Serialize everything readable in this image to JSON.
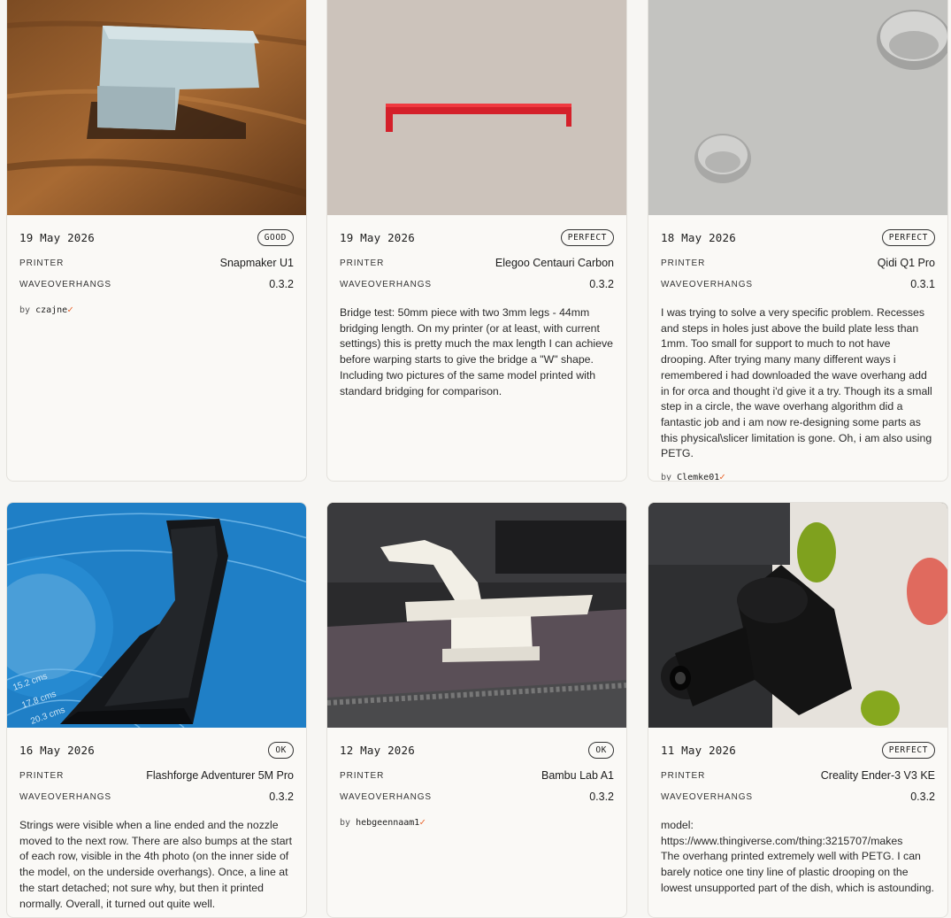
{
  "cards": [
    {
      "date": "19 May 2026",
      "rating": "GOOD",
      "printer_label": "PRINTER",
      "printer": "Snapmaker U1",
      "plugin_label": "WAVEOVERHANGS",
      "version": "0.3.2",
      "description": "",
      "by": "by",
      "author": "czajne",
      "verified": "✓",
      "image_icon": "photo-gray-block-on-wood"
    },
    {
      "date": "19 May 2026",
      "rating": "PERFECT",
      "printer_label": "PRINTER",
      "printer": "Elegoo Centauri Carbon",
      "plugin_label": "WAVEOVERHANGS",
      "version": "0.3.2",
      "description": "Bridge test: 50mm piece with two 3mm legs - 44mm bridging length. On my printer (or at least, with current settings) this is pretty much the max length I can achieve before warping starts to give the bridge a \"W\" shape. Including two pictures of the same model printed with standard bridging for comparison.",
      "by": "",
      "author": "",
      "verified": "",
      "image_icon": "photo-red-bridge"
    },
    {
      "date": "18 May 2026",
      "rating": "PERFECT",
      "printer_label": "PRINTER",
      "printer": "Qidi Q1 Pro",
      "plugin_label": "WAVEOVERHANGS",
      "version": "0.3.1",
      "description": "I was trying to solve a very specific problem. Recesses and steps in holes just above the build plate less than 1mm. Too small for support to much to not have drooping. After trying many many different ways i remembered i had downloaded the wave overhang add in for orca and thought i'd give it a try. Though its a small step in a circle, the wave overhang algorithm did a fantastic job and i am now re-designing some parts as this physical\\slicer limitation is gone. Oh, i am also using PETG.",
      "by": "by",
      "author": "Clemke01",
      "verified": "✓",
      "image_icon": "photo-gray-recesses"
    },
    {
      "date": "16 May 2026",
      "rating": "OK",
      "printer_label": "PRINTER",
      "printer": "Flashforge Adventurer 5M Pro",
      "plugin_label": "WAVEOVERHANGS",
      "version": "0.3.2",
      "description": "Strings were visible when a line ended and the nozzle moved to the next row. There are also bumps at the start of each row, visible in the 4th photo (on the inner side of the model, on the underside overhangs). Once, a line at the start detached; not sure why, but then it printed normally. Overall, it turned out quite well.",
      "by": "",
      "author": "",
      "verified": "",
      "image_icon": "photo-black-clip-on-blue-mat",
      "mat_labels": [
        "15.2 cms",
        "17.8 cms",
        "20.3 cms"
      ]
    },
    {
      "date": "12 May 2026",
      "rating": "OK",
      "printer_label": "PRINTER",
      "printer": "Bambu Lab A1",
      "plugin_label": "WAVEOVERHANGS",
      "version": "0.3.2",
      "description": "",
      "by": "by",
      "author": "hebgeennaam1",
      "verified": "✓",
      "image_icon": "photo-white-overhang-part"
    },
    {
      "date": "11 May 2026",
      "rating": "PERFECT",
      "printer_label": "PRINTER",
      "printer": "Creality Ender-3 V3 KE",
      "plugin_label": "WAVEOVERHANGS",
      "version": "0.3.2",
      "description": "model:\nhttps://www.thingiverse.com/thing:3215707/makes\nThe overhang printed extremely well with PETG. I can barely notice one tiny line of plastic drooping on the lowest unsupported part of the dish, which is astounding.",
      "by": "",
      "author": "",
      "verified": "",
      "image_icon": "photo-black-dish-print"
    }
  ]
}
